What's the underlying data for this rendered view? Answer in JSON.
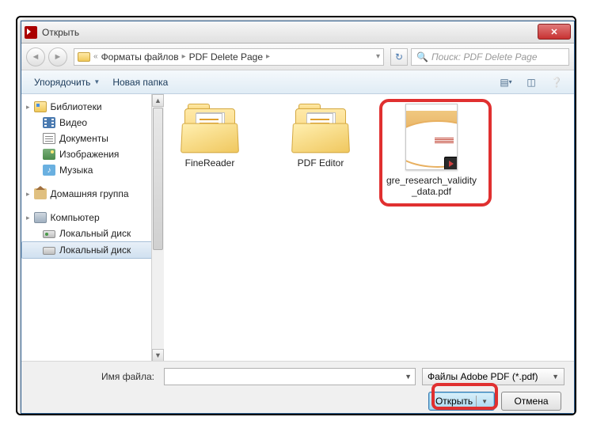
{
  "title": "Открыть",
  "breadcrumb": {
    "sep1": "«",
    "part1": "Форматы файлов",
    "part2": "PDF Delete Page"
  },
  "search": {
    "placeholder": "Поиск: PDF Delete Page"
  },
  "toolbar": {
    "organize": "Упорядочить",
    "new_folder": "Новая папка"
  },
  "sidebar": {
    "libraries": "Библиотеки",
    "video": "Видео",
    "documents": "Документы",
    "images": "Изображения",
    "music": "Музыка",
    "homegroup": "Домашняя группа",
    "computer": "Компьютер",
    "disk1": "Локальный диск",
    "disk2": "Локальный диск"
  },
  "files": {
    "folder1": "FineReader",
    "folder2": "PDF Editor",
    "pdf": "gre_research_validity_data.pdf"
  },
  "footer": {
    "filename_label": "Имя файла:",
    "filter": "Файлы Adobe PDF (*.pdf)",
    "open": "Открыть",
    "cancel": "Отмена"
  }
}
